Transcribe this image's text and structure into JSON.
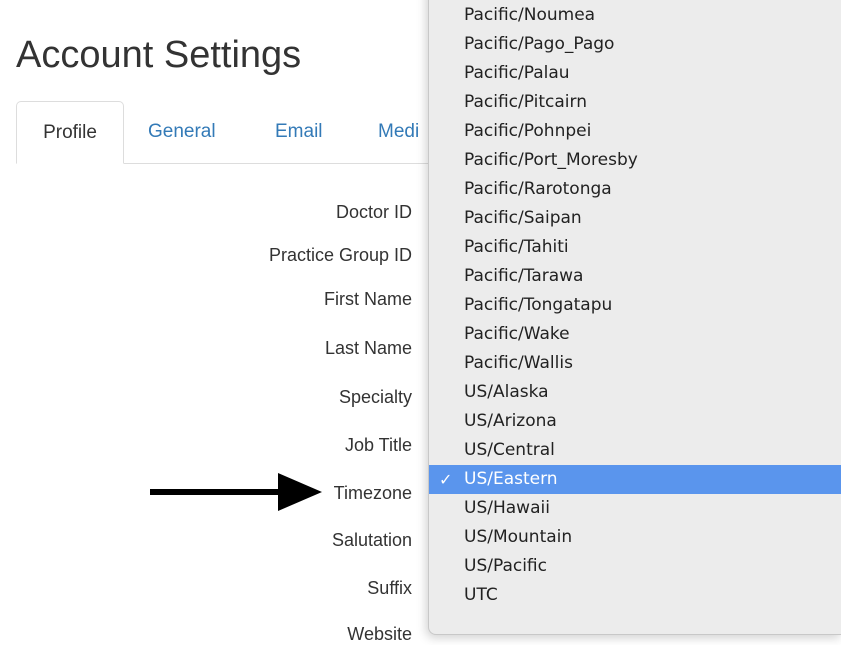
{
  "page": {
    "title": "Account Settings"
  },
  "tabs": [
    {
      "label": "Profile",
      "active": true
    },
    {
      "label": "General",
      "active": false
    },
    {
      "label": "Email",
      "active": false
    },
    {
      "label": "Medi",
      "active": false
    }
  ],
  "form": {
    "labels": [
      "Doctor ID",
      "Practice Group ID",
      "First Name",
      "Last Name",
      "Specialty",
      "Job Title",
      "Timezone",
      "Salutation",
      "Suffix",
      "Website"
    ]
  },
  "timezone_dropdown": {
    "selected": "US/Eastern",
    "check_glyph": "✓",
    "options": [
      "Pacific/Noumea",
      "Pacific/Pago_Pago",
      "Pacific/Palau",
      "Pacific/Pitcairn",
      "Pacific/Pohnpei",
      "Pacific/Port_Moresby",
      "Pacific/Rarotonga",
      "Pacific/Saipan",
      "Pacific/Tahiti",
      "Pacific/Tarawa",
      "Pacific/Tongatapu",
      "Pacific/Wake",
      "Pacific/Wallis",
      "US/Alaska",
      "US/Arizona",
      "US/Central",
      "US/Eastern",
      "US/Hawaii",
      "US/Mountain",
      "US/Pacific",
      "UTC"
    ]
  },
  "colors": {
    "link": "#337ab7",
    "selection": "#5a95ed",
    "menu_background": "#ececec"
  }
}
